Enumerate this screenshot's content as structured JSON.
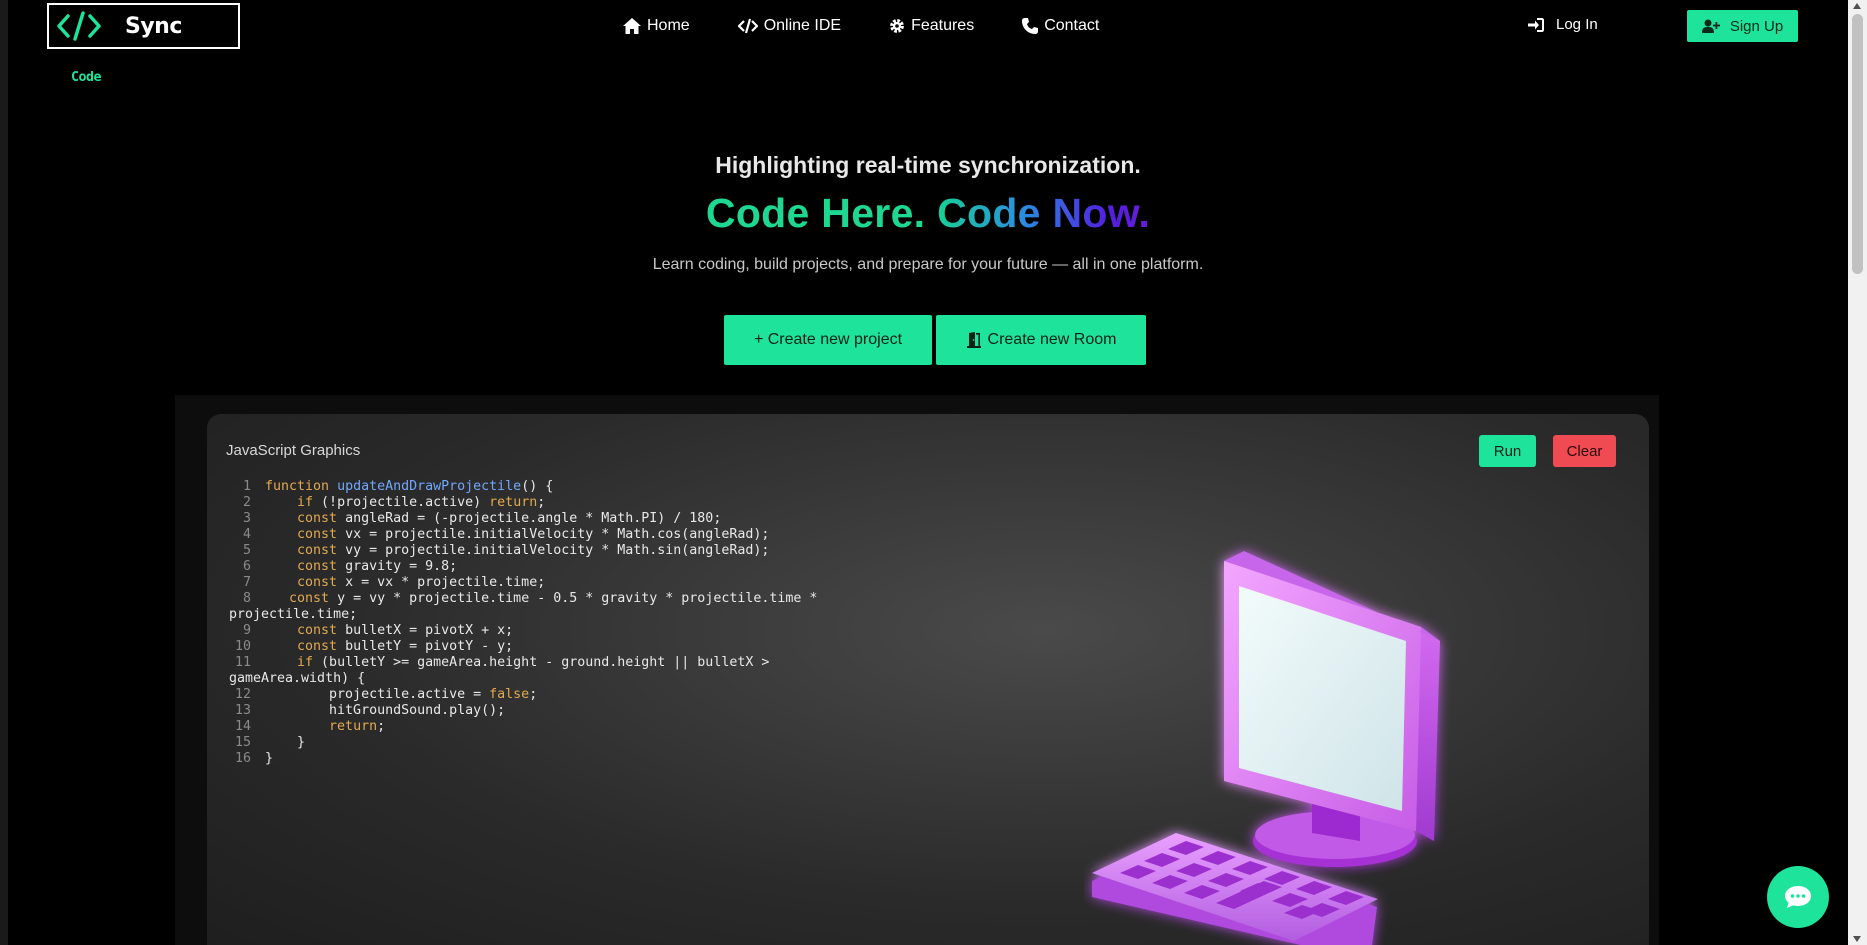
{
  "brand": {
    "name_part1": "Sync",
    "name_part2": "Code"
  },
  "nav": {
    "items": [
      {
        "label": "Home",
        "icon": "home-icon"
      },
      {
        "label": "Online IDE",
        "icon": "code-icon"
      },
      {
        "label": "Features",
        "icon": "gear-icon"
      },
      {
        "label": "Contact",
        "icon": "phone-icon"
      }
    ],
    "login_label": "Log In",
    "signup_label": "Sign Up"
  },
  "hero": {
    "subtitle": "Highlighting real-time synchronization.",
    "title_part1": "Code Here.",
    "title_part2": "Code Now.",
    "description": "Learn coding, build projects, and prepare for your future — all in one platform.",
    "create_project_label": "+ Create new project",
    "create_room_label": "Create new Room"
  },
  "editor": {
    "title": "JavaScript Graphics",
    "run_label": "Run",
    "clear_label": "Clear"
  },
  "colors": {
    "accent": "#1ee39a",
    "danger": "#f04a52",
    "background": "#000000"
  }
}
